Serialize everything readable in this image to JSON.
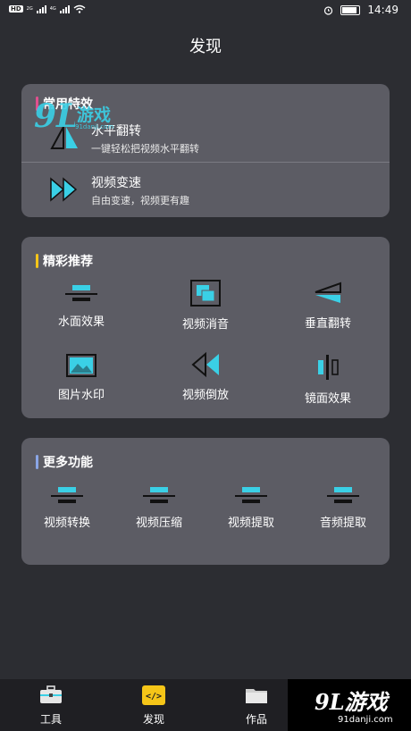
{
  "status": {
    "network": "HD",
    "signal1": "2G",
    "signal2": "4G",
    "time": "14:49"
  },
  "header": {
    "title": "发现"
  },
  "common": {
    "title": "常用特效",
    "items": [
      {
        "name": "水平翻转",
        "desc": "一键轻松把视频水平翻转",
        "icon": "flip-horizontal-icon"
      },
      {
        "name": "视频变速",
        "desc": "自由变速，视频更有趣",
        "icon": "fast-forward-icon"
      }
    ]
  },
  "featured": {
    "title": "精彩推荐",
    "items": [
      {
        "label": "水面效果",
        "icon": "water-surface-icon"
      },
      {
        "label": "视频消音",
        "icon": "mute-icon"
      },
      {
        "label": "垂直翻转",
        "icon": "flip-vertical-icon"
      },
      {
        "label": "图片水印",
        "icon": "image-watermark-icon"
      },
      {
        "label": "视频倒放",
        "icon": "rewind-icon"
      },
      {
        "label": "镜面效果",
        "icon": "mirror-icon"
      }
    ]
  },
  "more": {
    "title": "更多功能",
    "items": [
      {
        "label": "视频转换",
        "icon": "convert-icon"
      },
      {
        "label": "视频压缩",
        "icon": "compress-icon"
      },
      {
        "label": "视频提取",
        "icon": "extract-icon"
      },
      {
        "label": "音频提取",
        "icon": "audio-extract-icon"
      }
    ]
  },
  "watermark": {
    "top_text": "游戏",
    "top_sub": "91danji.com"
  },
  "tabs": [
    {
      "label": "工具",
      "icon": "toolbox-icon",
      "active": false
    },
    {
      "label": "发现",
      "icon": "code-icon",
      "active": true
    },
    {
      "label": "作品",
      "icon": "folder-icon",
      "active": false
    }
  ],
  "brand": {
    "name": "9L游戏",
    "url": "91danji.com"
  },
  "colors": {
    "accent_teal": "#3ad0e6",
    "accent_yellow": "#f5c518",
    "card": "#5c5c64",
    "bg": "#2c2d32"
  }
}
